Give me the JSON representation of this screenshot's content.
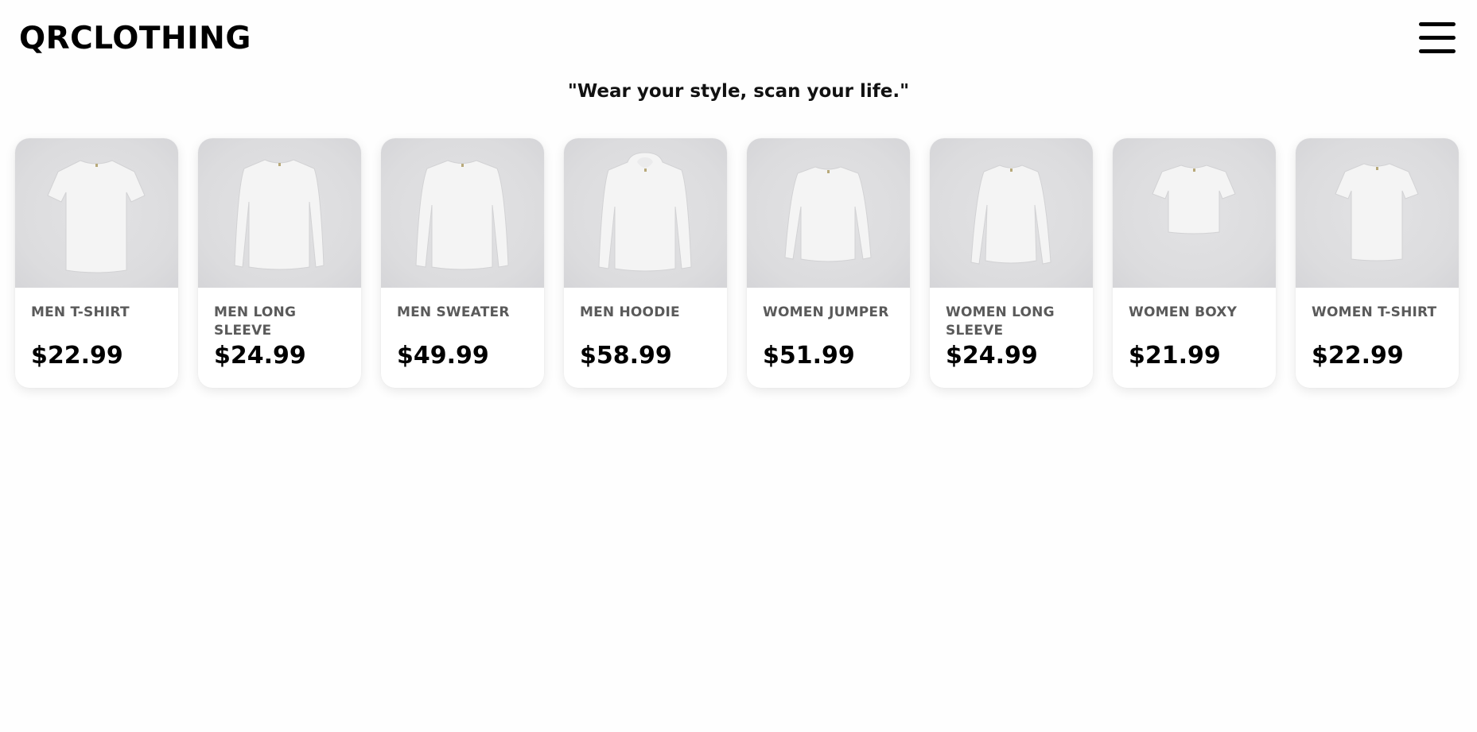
{
  "header": {
    "logo": "QRCLOTHING",
    "menu_icon": "hamburger-menu-icon"
  },
  "tagline": "\"Wear your style, scan your life.\"",
  "products": [
    {
      "name": "MEN T-SHIRT",
      "price": "$22.99",
      "garment": "tshirt"
    },
    {
      "name": "MEN LONG SLEEVE",
      "price": "$24.99",
      "garment": "longsleeve"
    },
    {
      "name": "MEN SWEATER",
      "price": "$49.99",
      "garment": "sweater"
    },
    {
      "name": "MEN HOODIE",
      "price": "$58.99",
      "garment": "hoodie"
    },
    {
      "name": "WOMEN JUMPER",
      "price": "$51.99",
      "garment": "jumper"
    },
    {
      "name": "WOMEN LONG SLEEVE",
      "price": "$24.99",
      "garment": "longsleeve-fitted"
    },
    {
      "name": "WOMEN BOXY",
      "price": "$21.99",
      "garment": "boxy"
    },
    {
      "name": "WOMEN T-SHIRT",
      "price": "$22.99",
      "garment": "tshirt-women"
    }
  ],
  "colors": {
    "background": "#fefefe",
    "card_image_bg": "#dcdcde",
    "name_text": "#5a5a5a",
    "price_text": "#000000"
  }
}
